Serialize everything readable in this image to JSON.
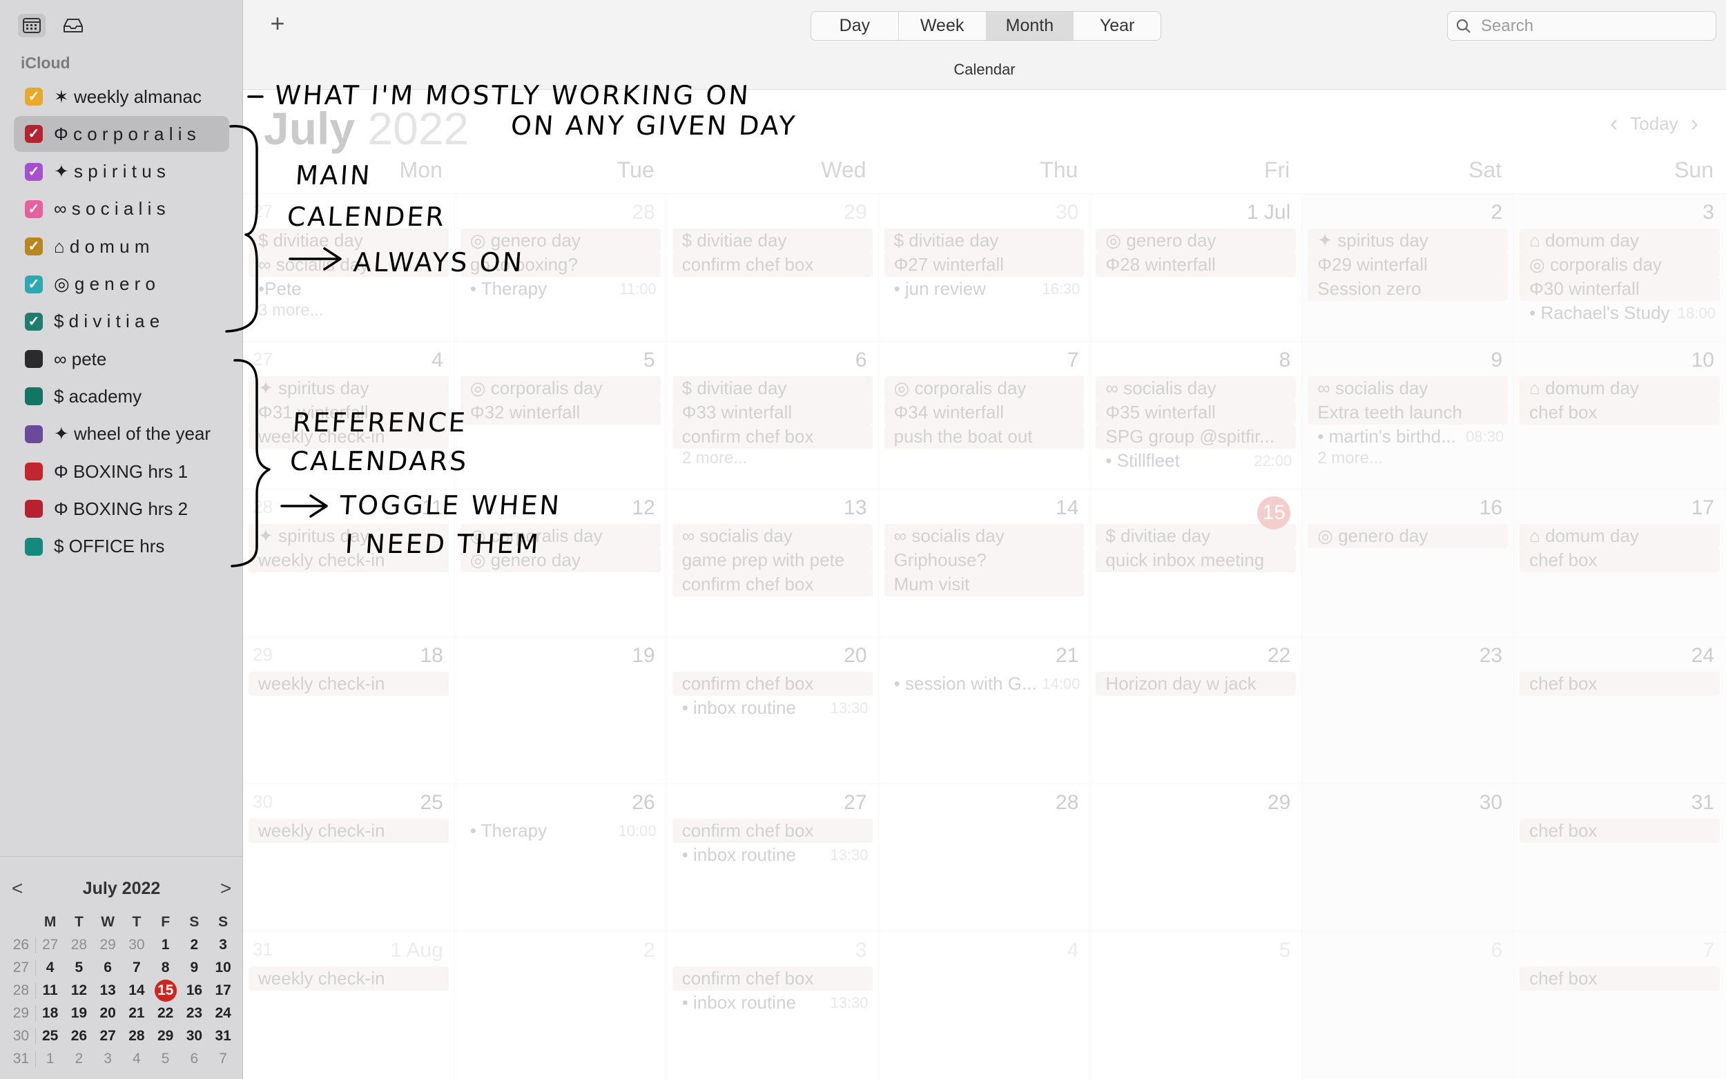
{
  "sidebar": {
    "icons": [
      "calendar-icon",
      "inbox-icon"
    ],
    "section": "iCloud",
    "calendars": [
      {
        "label": "✶ weekly almanac",
        "color": "#e8a92a",
        "checked": true,
        "spaced": false
      },
      {
        "label": "Φ c o r p o r a l i s",
        "color": "#b3242f",
        "checked": true,
        "spaced": false
      },
      {
        "label": "✦ s p i r i t u s",
        "color": "#a64fd1",
        "checked": true,
        "spaced": false
      },
      {
        "label": "∞ s o c i a l i s",
        "color": "#e85fa0",
        "checked": true,
        "spaced": false
      },
      {
        "label": "⌂ d o m u m",
        "color": "#b8861c",
        "checked": true,
        "spaced": false
      },
      {
        "label": "◎ g e n e r o",
        "color": "#2ea8b3",
        "checked": true,
        "spaced": false
      },
      {
        "label": "$ d i v i t i a e",
        "color": "#1e7d6e",
        "checked": true,
        "spaced": false
      },
      {
        "label": "∞ pete",
        "color": "#2b2a2d",
        "checked": false,
        "spaced": false
      },
      {
        "label": "$ academy",
        "color": "#137564",
        "checked": false,
        "spaced": false
      },
      {
        "label": "✦ wheel of the year",
        "color": "#6a4a9a",
        "checked": false,
        "spaced": false
      },
      {
        "label": "Φ BOXING hrs  1",
        "color": "#c2272f",
        "checked": false,
        "spaced": false
      },
      {
        "label": "Φ BOXING  hrs  2",
        "color": "#b8222f",
        "checked": false,
        "spaced": false
      },
      {
        "label": "$  OFFICE  hrs",
        "color": "#138a7c",
        "checked": false,
        "spaced": false
      }
    ],
    "mini_calendar": {
      "title": "July 2022",
      "prev": "<",
      "next": ">",
      "headers": [
        "M",
        "T",
        "W",
        "T",
        "F",
        "S",
        "S"
      ],
      "weeks": [
        {
          "wk": "26",
          "days": [
            "27",
            "28",
            "29",
            "30",
            "1",
            "2",
            "3"
          ]
        },
        {
          "wk": "27",
          "days": [
            "4",
            "5",
            "6",
            "7",
            "8",
            "9",
            "10"
          ]
        },
        {
          "wk": "28",
          "days": [
            "11",
            "12",
            "13",
            "14",
            "15",
            "16",
            "17"
          ]
        },
        {
          "wk": "29",
          "days": [
            "18",
            "19",
            "20",
            "21",
            "22",
            "23",
            "24"
          ]
        },
        {
          "wk": "30",
          "days": [
            "25",
            "26",
            "27",
            "28",
            "29",
            "30",
            "31"
          ]
        },
        {
          "wk": "31",
          "days": [
            "1",
            "2",
            "3",
            "4",
            "5",
            "6",
            "7"
          ]
        }
      ],
      "today": "15"
    }
  },
  "toolbar": {
    "add": "+",
    "views": [
      "Day",
      "Week",
      "Month",
      "Year"
    ],
    "active_view": "Month",
    "search_placeholder": "Search",
    "window_title": "Calendar"
  },
  "month": {
    "title_month": "July",
    "title_year": "2022",
    "today_label": "Today",
    "weekdays": [
      "Mon",
      "Tue",
      "Wed",
      "Thu",
      "Fri",
      "Sat",
      "Sun"
    ],
    "weeks": [
      {
        "wk": "27",
        "days": [
          {
            "n": "",
            "dim": true,
            "events": [
              "$ divitiae day",
              "∞ socialis day",
              "•Pete",
              "3 more..."
            ]
          },
          {
            "n": "28",
            "dim": true,
            "events": [
              "◎ genero day",
              "go to boxing?",
              "• Therapy|11:00"
            ]
          },
          {
            "n": "29",
            "dim": true,
            "events": [
              "$ divitiae day",
              "confirm chef box"
            ]
          },
          {
            "n": "30",
            "dim": true,
            "events": [
              "$ divitiae day",
              "Φ27 winterfall",
              "• jun review|16:30"
            ]
          },
          {
            "n": "1 Jul",
            "dim": false,
            "events": [
              "◎ genero day",
              "Φ28 winterfall"
            ]
          },
          {
            "n": "2",
            "dim": false,
            "events": [
              "✦ spiritus day",
              "Φ29 winterfall",
              "Session zero"
            ]
          },
          {
            "n": "3",
            "dim": false,
            "events": [
              "⌂ domum day",
              "◎ corporalis day",
              "Φ30 winterfall",
              "• Rachael's Study|18:00"
            ]
          }
        ]
      },
      {
        "wk": "27",
        "days": [
          {
            "n": "4",
            "dim": false,
            "events": [
              "✦ spiritus day",
              "Φ31 winterfall",
              "weekly check-in"
            ]
          },
          {
            "n": "5",
            "dim": false,
            "events": [
              "◎ corporalis day",
              "Φ32 winterfall"
            ]
          },
          {
            "n": "6",
            "dim": false,
            "events": [
              "$ divitiae day",
              "Φ33 winterfall",
              "confirm chef box",
              "2 more..."
            ]
          },
          {
            "n": "7",
            "dim": false,
            "events": [
              "◎ corporalis day",
              "Φ34 winterfall",
              "push the boat out"
            ]
          },
          {
            "n": "8",
            "dim": false,
            "events": [
              "∞ socialis day",
              "Φ35 winterfall",
              "SPG group @spitfir...",
              "• Stillfleet|22:00"
            ]
          },
          {
            "n": "9",
            "dim": false,
            "events": [
              "∞ socialis day",
              "Extra teeth launch",
              "• martin's birthd...|08:30",
              "2 more..."
            ]
          },
          {
            "n": "10",
            "dim": false,
            "events": [
              "⌂ domum day",
              "chef box"
            ]
          }
        ]
      },
      {
        "wk": "28",
        "days": [
          {
            "n": "11",
            "dim": false,
            "events": [
              "✦ spiritus day",
              "weekly check-in"
            ]
          },
          {
            "n": "12",
            "dim": false,
            "events": [
              "◎ corporalis day",
              "◎ genero day"
            ]
          },
          {
            "n": "13",
            "dim": false,
            "events": [
              "∞ socialis day",
              "game prep with pete",
              "confirm chef box"
            ]
          },
          {
            "n": "14",
            "dim": false,
            "events": [
              "∞ socialis day",
              "Griphouse?",
              "Mum visit"
            ]
          },
          {
            "n": "15",
            "dim": false,
            "today": true,
            "events": [
              "$ divitiae day",
              "quick inbox meeting"
            ]
          },
          {
            "n": "16",
            "dim": false,
            "events": [
              "◎ genero day"
            ]
          },
          {
            "n": "17",
            "dim": false,
            "events": [
              "⌂ domum day",
              "chef box"
            ]
          }
        ]
      },
      {
        "wk": "29",
        "days": [
          {
            "n": "18",
            "dim": false,
            "events": [
              "weekly check-in"
            ]
          },
          {
            "n": "19",
            "dim": false,
            "events": []
          },
          {
            "n": "20",
            "dim": false,
            "events": [
              "confirm chef box",
              "• inbox routine|13:30"
            ]
          },
          {
            "n": "21",
            "dim": false,
            "events": [
              "• session with G...|14:00"
            ]
          },
          {
            "n": "22",
            "dim": false,
            "events": [
              "Horizon day w jack"
            ]
          },
          {
            "n": "23",
            "dim": false,
            "events": []
          },
          {
            "n": "24",
            "dim": false,
            "events": [
              "chef box"
            ]
          }
        ]
      },
      {
        "wk": "30",
        "days": [
          {
            "n": "25",
            "dim": false,
            "events": [
              "weekly check-in"
            ]
          },
          {
            "n": "26",
            "dim": false,
            "events": [
              "• Therapy|10:00"
            ]
          },
          {
            "n": "27",
            "dim": false,
            "events": [
              "confirm chef box",
              "• inbox routine|13:30"
            ]
          },
          {
            "n": "28",
            "dim": false,
            "events": []
          },
          {
            "n": "29",
            "dim": false,
            "events": []
          },
          {
            "n": "30",
            "dim": false,
            "events": []
          },
          {
            "n": "31",
            "dim": false,
            "events": [
              "chef box"
            ]
          }
        ]
      },
      {
        "wk": "31",
        "days": [
          {
            "n": "1 Aug",
            "dim": true,
            "events": [
              "weekly check-in"
            ]
          },
          {
            "n": "2",
            "dim": true,
            "events": []
          },
          {
            "n": "3",
            "dim": true,
            "events": [
              "confirm chef box",
              "• inbox routine|13:30"
            ]
          },
          {
            "n": "4",
            "dim": true,
            "events": []
          },
          {
            "n": "5",
            "dim": true,
            "events": []
          },
          {
            "n": "6",
            "dim": true,
            "events": []
          },
          {
            "n": "7",
            "dim": true,
            "events": [
              "chef box"
            ]
          }
        ]
      }
    ]
  },
  "annotations": {
    "line1": "WHAT I'M MOSTLY WORKING ON",
    "line2": "ON ANY GIVEN DAY",
    "main1": "MAIN",
    "main2": "CALENDER",
    "main3": "ALWAYS ON",
    "ref1": "REFERENCE",
    "ref2": "CALENDARS",
    "ref3": "TOGGLE WHEN",
    "ref4": "I NEED THEM"
  }
}
